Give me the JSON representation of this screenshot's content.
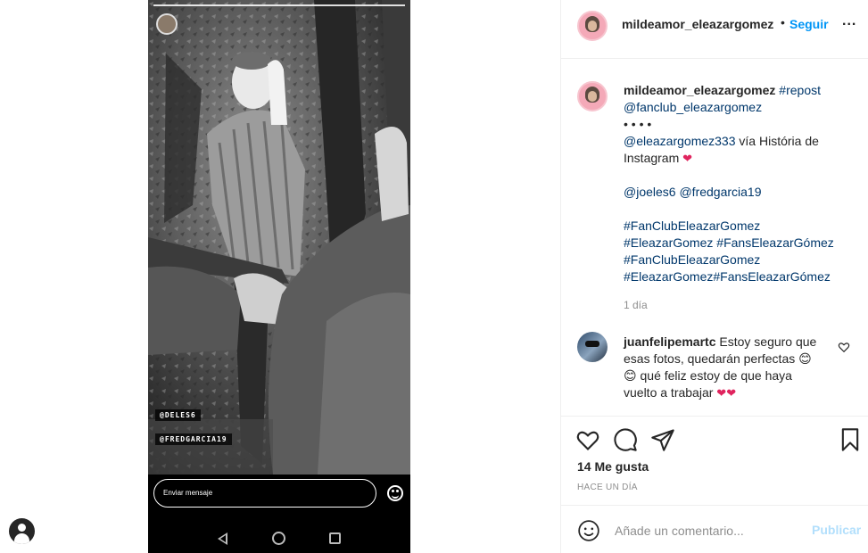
{
  "story": {
    "message_placeholder": "Enviar mensaje",
    "tags": [
      "@DELES6",
      "@FREDGARCIA19"
    ]
  },
  "post": {
    "username": "mildeamor_eleazargomez",
    "follow_label": "Seguir",
    "more_label": "...",
    "dot": "•",
    "caption": {
      "username": "mildeamor_eleazargomez",
      "hashtag_repost": "#repost",
      "mention_fanclub": "@fanclub_eleazargomez",
      "dots_line": "• • • •",
      "mention_eleazar": "@eleazargomez333",
      "via_text": " vía História de",
      "instagram_text": "Instagram",
      "mention_joeles": "@joeles6",
      "mention_fred": "@fredgarcia19",
      "hashtag_1": "#FanClubEleazarGomez",
      "hashtag_2": "#EleazarGomez",
      "hashtag_3": "#FansEleazarGómez",
      "hashtag_4": "#FanClubEleazarGomez",
      "hashtag_5": "#EleazarGomez#FansEleazarGómez",
      "time": "1 día"
    },
    "comment": {
      "username": "juanfelipemartc",
      "text_1": " Estoy seguro que",
      "text_2": "esas fotos, quedarán perfectas",
      "text_3": " qué feliz estoy de que haya",
      "text_4": "vuelto a trabajar"
    },
    "likes": "14 Me gusta",
    "post_time": "HACE UN DÍA",
    "add_comment_placeholder": "Añade un comentario...",
    "publish_label": "Publicar"
  },
  "colors": {
    "link": "#00376b",
    "follow": "#0095f6",
    "publish_disabled": "#b2dffc",
    "muted": "#8e8e8e"
  },
  "icons": [
    "heart-icon",
    "comment-icon",
    "share-icon",
    "bookmark-icon",
    "emoji-icon",
    "profile-icon",
    "back-icon",
    "home-icon",
    "recent-apps-icon"
  ]
}
